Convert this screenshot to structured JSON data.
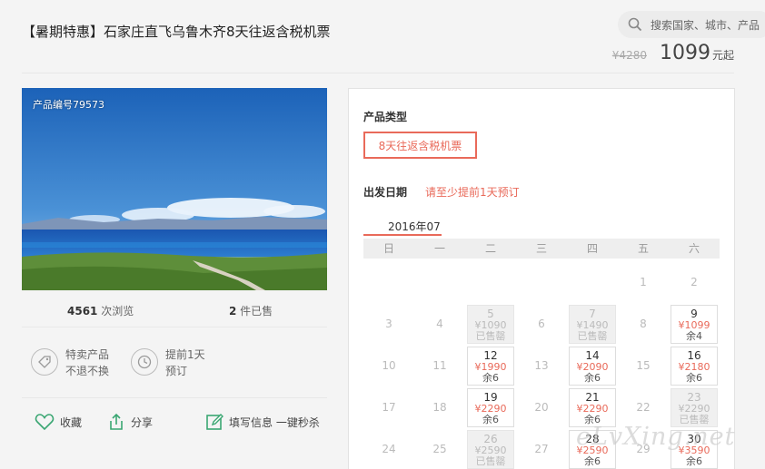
{
  "header": {
    "title": "【暑期特惠】石家庄直飞乌鲁木齐8天往返含税机票",
    "search_placeholder": "搜索国家、城市、产品",
    "old_price": "¥4280",
    "price": "1099",
    "price_unit": "元起"
  },
  "product": {
    "id_label": "产品编号79573",
    "views_num": "4561",
    "views_text": " 次浏览",
    "sold_num": "2",
    "sold_text": " 件已售"
  },
  "features": [
    {
      "icon": "tag-icon",
      "line1": "特卖产品",
      "line2": "不退不换"
    },
    {
      "icon": "clock-icon",
      "line1": "提前1天",
      "line2": "预订"
    }
  ],
  "actions": {
    "favorite": "收藏",
    "share": "分享",
    "fill": "填写信息 一键秒杀"
  },
  "booking": {
    "type_label": "产品类型",
    "type_option": "8天往返含税机票",
    "date_label": "出发日期",
    "date_hint": "请至少提前1天预订",
    "month": "2016年07",
    "weekdays": [
      "日",
      "一",
      "二",
      "三",
      "四",
      "五",
      "六"
    ]
  },
  "calendar": [
    {
      "day": "1",
      "state": "empty"
    },
    {
      "day": "2",
      "state": "empty"
    },
    {
      "day": "3",
      "state": "empty"
    },
    {
      "day": "4",
      "state": "empty"
    },
    {
      "day": "5",
      "state": "sold",
      "price": "¥1090",
      "remain": "已售罄"
    },
    {
      "day": "6",
      "state": "empty"
    },
    {
      "day": "7",
      "state": "sold",
      "price": "¥1490",
      "remain": "已售罄"
    },
    {
      "day": "8",
      "state": "empty"
    },
    {
      "day": "9",
      "state": "active",
      "price": "¥1099",
      "remain": "余4"
    },
    {
      "day": "10",
      "state": "empty"
    },
    {
      "day": "11",
      "state": "empty"
    },
    {
      "day": "12",
      "state": "active",
      "price": "¥1990",
      "remain": "余6"
    },
    {
      "day": "13",
      "state": "empty"
    },
    {
      "day": "14",
      "state": "active",
      "price": "¥2090",
      "remain": "余6"
    },
    {
      "day": "15",
      "state": "empty"
    },
    {
      "day": "16",
      "state": "active",
      "price": "¥2180",
      "remain": "余6"
    },
    {
      "day": "17",
      "state": "empty"
    },
    {
      "day": "18",
      "state": "empty"
    },
    {
      "day": "19",
      "state": "active",
      "price": "¥2290",
      "remain": "余6"
    },
    {
      "day": "20",
      "state": "empty"
    },
    {
      "day": "21",
      "state": "active",
      "price": "¥2290",
      "remain": "余6"
    },
    {
      "day": "22",
      "state": "empty"
    },
    {
      "day": "23",
      "state": "sold",
      "price": "¥2290",
      "remain": "已售罄"
    },
    {
      "day": "24",
      "state": "empty"
    },
    {
      "day": "25",
      "state": "empty"
    },
    {
      "day": "26",
      "state": "sold",
      "price": "¥2590",
      "remain": "已售罄"
    },
    {
      "day": "27",
      "state": "empty"
    },
    {
      "day": "28",
      "state": "active",
      "price": "¥2590",
      "remain": "余6"
    },
    {
      "day": "29",
      "state": "empty"
    },
    {
      "day": "30",
      "state": "active",
      "price": "¥3590",
      "remain": "余6"
    }
  ],
  "calendar_first_weekday": 5,
  "watermark": "eLvXing.net",
  "colors": {
    "accent": "#e96a5a",
    "green": "#3aa672"
  }
}
